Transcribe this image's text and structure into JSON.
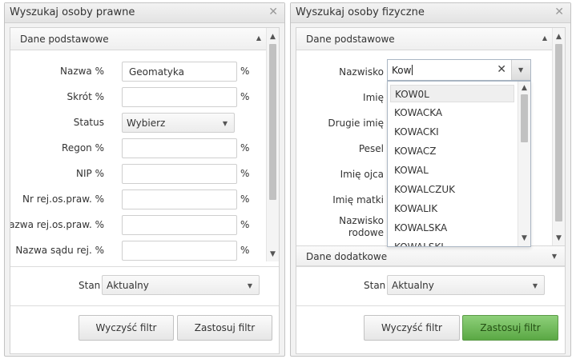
{
  "left_panel": {
    "title": "Wyszukaj osoby prawne",
    "section_title": "Dane podstawowe",
    "fields": [
      {
        "label": "Nazwa %",
        "value": "Geomatyka",
        "suffix": "%"
      },
      {
        "label": "Skrót %",
        "value": "",
        "suffix": "%"
      },
      {
        "label": "Regon %",
        "value": "",
        "suffix": "%"
      },
      {
        "label": "NIP %",
        "value": "",
        "suffix": "%"
      },
      {
        "label": "Nr rej.os.praw. %",
        "value": "",
        "suffix": "%"
      },
      {
        "label": "Nazwa rej.os.praw. %",
        "value": "",
        "suffix": "%"
      },
      {
        "label": "Nazwa sądu rej. %",
        "value": "",
        "suffix": "%"
      }
    ],
    "status": {
      "label": "Status",
      "value": "Wybierz"
    },
    "stan": {
      "label": "Stan",
      "value": "Aktualny"
    },
    "clear_button": "Wyczyść filtr",
    "apply_button": "Zastosuj filtr"
  },
  "right_panel": {
    "title": "Wyszukaj osoby fizyczne",
    "section_title": "Dane podstawowe",
    "section2_title": "Dane dodatkowe",
    "labels": {
      "nazwisko": "Nazwisko",
      "imie": "Imię",
      "drugie_imie": "Drugie imię",
      "pesel": "Pesel",
      "imie_ojca": "Imię ojca",
      "imie_matki": "Imię matki",
      "nazwisko_rodowe_1": "Nazwisko",
      "nazwisko_rodowe_2": "rodowe"
    },
    "nazwisko_value": "Kow",
    "suggestions": [
      "KOW0L",
      "KOWACKA",
      "KOWACKI",
      "KOWACZ",
      "KOWAL",
      "KOWALCZUK",
      "KOWALIK",
      "KOWALSKA",
      "KOWALSKI"
    ],
    "stan": {
      "label": "Stan",
      "value": "Aktualny"
    },
    "clear_button": "Wyczyść filtr",
    "apply_button": "Zastosuj filtr"
  },
  "colors": {
    "apply_green": "#6cba55",
    "panel_bg": "#f2f2f2",
    "border": "#c3c3c3"
  }
}
